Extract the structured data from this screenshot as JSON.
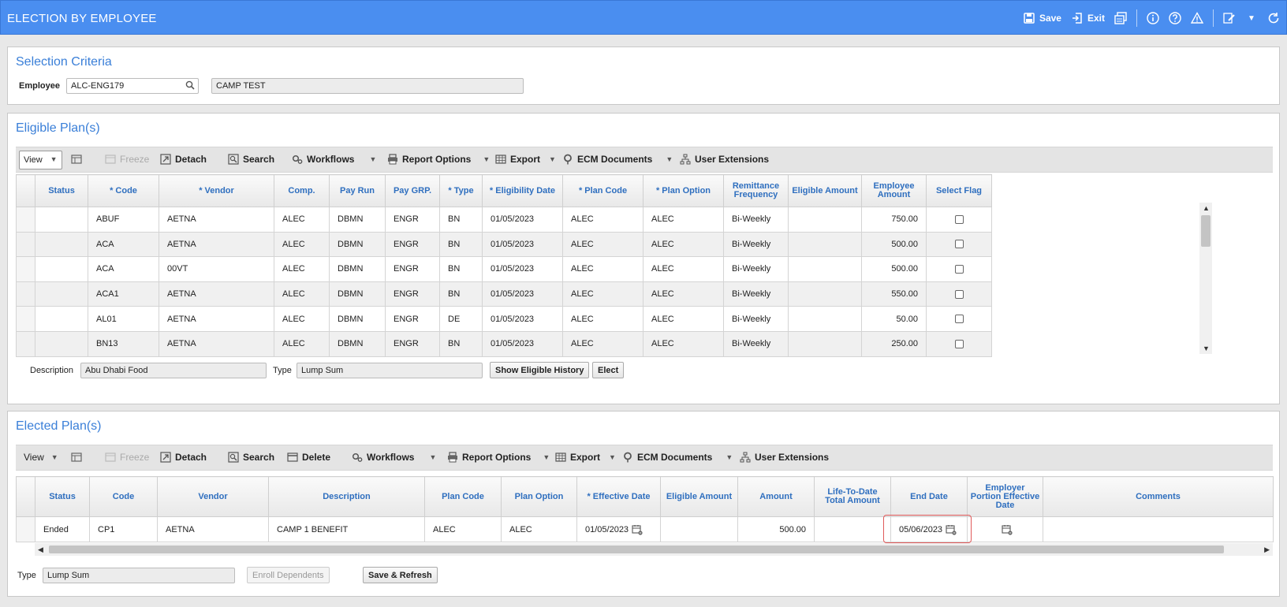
{
  "window": {
    "title": "ELECTION BY EMPLOYEE"
  },
  "header": {
    "save_label": "Save",
    "exit_label": "Exit"
  },
  "selection": {
    "title": "Selection Criteria",
    "employee_label": "Employee",
    "employee_value": "ALC-ENG179",
    "employee_name": "CAMP TEST"
  },
  "eligible": {
    "title": "Eligible Plan(s)",
    "toolbar": {
      "view": "View",
      "freeze": "Freeze",
      "detach": "Detach",
      "search": "Search",
      "workflows": "Workflows",
      "report_options": "Report Options",
      "export": "Export",
      "ecm": "ECM Documents",
      "user_ext": "User Extensions"
    },
    "columns": [
      "Status",
      "* Code",
      "* Vendor",
      "Comp.",
      "Pay Run",
      "Pay GRP.",
      "* Type",
      "* Eligibility Date",
      "* Plan Code",
      "* Plan Option",
      "Remittance Frequency",
      "Eligible Amount",
      "Employee Amount",
      "Select Flag"
    ],
    "rows": [
      [
        "",
        "ABUF",
        "AETNA",
        "ALEC",
        "DBMN",
        "ENGR",
        "BN",
        "01/05/2023",
        "ALEC",
        "ALEC",
        "Bi-Weekly",
        "",
        "750.00"
      ],
      [
        "",
        "ACA",
        "AETNA",
        "ALEC",
        "DBMN",
        "ENGR",
        "BN",
        "01/05/2023",
        "ALEC",
        "ALEC",
        "Bi-Weekly",
        "",
        "500.00"
      ],
      [
        "",
        "ACA",
        "00VT",
        "ALEC",
        "DBMN",
        "ENGR",
        "BN",
        "01/05/2023",
        "ALEC",
        "ALEC",
        "Bi-Weekly",
        "",
        "500.00"
      ],
      [
        "",
        "ACA1",
        "AETNA",
        "ALEC",
        "DBMN",
        "ENGR",
        "BN",
        "01/05/2023",
        "ALEC",
        "ALEC",
        "Bi-Weekly",
        "",
        "550.00"
      ],
      [
        "",
        "AL01",
        "AETNA",
        "ALEC",
        "DBMN",
        "ENGR",
        "DE",
        "01/05/2023",
        "ALEC",
        "ALEC",
        "Bi-Weekly",
        "",
        "50.00"
      ],
      [
        "",
        "BN13",
        "AETNA",
        "ALEC",
        "DBMN",
        "ENGR",
        "BN",
        "01/05/2023",
        "ALEC",
        "ALEC",
        "Bi-Weekly",
        "",
        "250.00"
      ]
    ],
    "description_label": "Description",
    "description_value": "Abu Dhabi Food",
    "type_label": "Type",
    "type_value": "Lump Sum",
    "show_history": "Show Eligible History",
    "elect": "Elect"
  },
  "elected": {
    "title": "Elected Plan(s)",
    "toolbar": {
      "view": "View",
      "freeze": "Freeze",
      "detach": "Detach",
      "search": "Search",
      "delete": "Delete",
      "workflows": "Workflows",
      "report_options": "Report Options",
      "export": "Export",
      "ecm": "ECM Documents",
      "user_ext": "User Extensions"
    },
    "columns": [
      "Status",
      "Code",
      "Vendor",
      "Description",
      "Plan Code",
      "Plan Option",
      "* Effective Date",
      "Eligible Amount",
      "Amount",
      "Life-To-Date Total Amount",
      "End Date",
      "Employer Portion Effective Date",
      "Comments"
    ],
    "rows": [
      [
        "Ended",
        "CP1",
        "AETNA",
        "CAMP 1 BENEFIT",
        "ALEC",
        "ALEC",
        "01/05/2023",
        "",
        "500.00",
        "",
        "05/06/2023",
        "",
        ""
      ]
    ],
    "type_label": "Type",
    "type_value": "Lump Sum",
    "enroll": "Enroll Dependents",
    "save_refresh": "Save & Refresh"
  }
}
